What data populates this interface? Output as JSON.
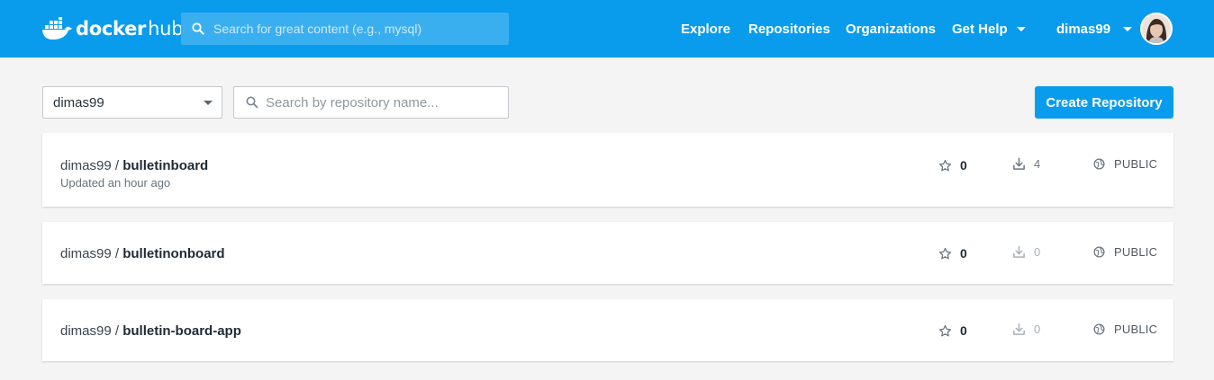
{
  "header": {
    "logo": {
      "word1": "docker",
      "word2": "hub"
    },
    "search_placeholder": "Search for great content (e.g., mysql)",
    "nav": {
      "explore": "Explore",
      "repositories": "Repositories",
      "organizations": "Organizations",
      "get_help": "Get Help",
      "username": "dimas99"
    }
  },
  "toolbar": {
    "namespace": "dimas99",
    "repo_search_placeholder": "Search by repository name...",
    "create_label": "Create Repository"
  },
  "repos": [
    {
      "owner": "dimas99",
      "separator": " / ",
      "name": "bulletinboard",
      "updated": "Updated an hour ago",
      "stars": "0",
      "pulls": "4",
      "visibility": "PUBLIC"
    },
    {
      "owner": "dimas99",
      "separator": " / ",
      "name": "bulletinonboard",
      "stars": "0",
      "pulls": "0",
      "visibility": "PUBLIC"
    },
    {
      "owner": "dimas99",
      "separator": " / ",
      "name": "bulletin-board-app",
      "stars": "0",
      "pulls": "0",
      "visibility": "PUBLIC"
    }
  ],
  "colors": {
    "brand": "#099cec",
    "background": "#f4f4f4"
  },
  "icons": [
    "docker-whale-icon",
    "search-icon",
    "chevron-down-icon",
    "star-icon",
    "download-icon",
    "globe-icon"
  ]
}
